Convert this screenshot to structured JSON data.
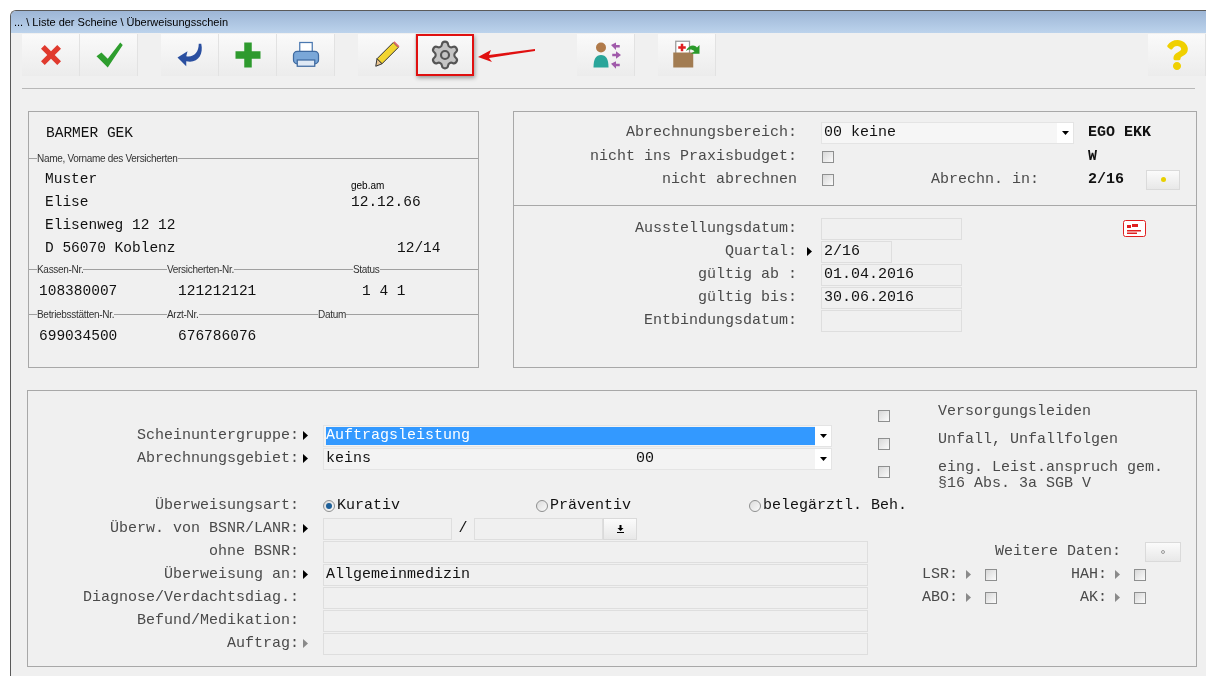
{
  "window": {
    "title": "... \\ Liste der Scheine \\ Überweisungsschein"
  },
  "toolbar": [
    [
      {
        "kind": "cancel",
        "marked": false
      },
      {
        "kind": "confirm",
        "marked": false
      }
    ],
    [
      {
        "kind": "undo",
        "marked": false
      },
      {
        "kind": "add",
        "marked": false
      },
      {
        "kind": "print",
        "marked": false
      }
    ],
    [
      {
        "kind": "edit",
        "marked": false
      },
      {
        "kind": "settings",
        "marked": true
      }
    ],
    [
      {
        "kind": "person-transfer",
        "marked": false
      }
    ],
    [
      {
        "kind": "folder-import",
        "marked": false
      }
    ],
    [
      {
        "kind": "help",
        "marked": false
      }
    ]
  ],
  "insurance_card": {
    "insurer": "BARMER GEK",
    "name_label": "Name, Vorname des Versicherten",
    "surname": "Muster",
    "dob_label": "geb.am",
    "first_name": "Elise",
    "dob": "12.12.66",
    "street": "Elisenweg 12 12",
    "city": "D 56070 Koblenz",
    "card_valid": "12/14",
    "rows": [
      [
        {
          "label": "Kassen-Nr.",
          "value": "108380007"
        },
        {
          "label": "Versicherten-Nr.",
          "value": "121212121"
        },
        {
          "label": "Status",
          "value": "1 4 1"
        }
      ],
      [
        {
          "label": "Betriebsstätten-Nr.",
          "value": "699034500"
        },
        {
          "label": "Arzt-Nr.",
          "value": "676786076"
        },
        {
          "label": "Datum"
        }
      ]
    ]
  },
  "billing": {
    "area_label": "Abrechnungsbereich:",
    "area_value": "00 keine",
    "codes": "EGO EKK",
    "budget_label": "nicht ins Praxisbudget:",
    "budget_checked": false,
    "type_code": "W",
    "no_bill_label": "nicht abrechnen",
    "no_bill_checked": false,
    "bill_in_label": "Abrechn. in:",
    "bill_in": "2/16"
  },
  "dates": [
    {
      "kind": "wide",
      "label": "Ausstellungsdatum:"
    },
    {
      "kind": "short",
      "label": "Quartal:",
      "arrow": true,
      "arrow_disabled": false,
      "value": "2/16"
    },
    {
      "kind": "wide",
      "label": "gültig ab :",
      "value": "01.04.2016"
    },
    {
      "kind": "wide",
      "label": "gültig bis:",
      "value": "30.06.2016"
    },
    {
      "kind": "wide",
      "label": "Entbindungsdatum:"
    }
  ],
  "dropdowns": [
    {
      "label": "Scheinuntergruppe:",
      "arrow": true,
      "arrow_disabled": false,
      "value": "Auftragsleistung",
      "selected": true
    },
    {
      "label": "Abrechnungsgebiet:",
      "arrow": true,
      "arrow_disabled": false,
      "value": "keins",
      "code": "00",
      "selected": false
    }
  ],
  "flags": [
    {
      "label": "Versorgungsleiden",
      "checked": false
    },
    {
      "label": "Unfall, Unfallfolgen",
      "checked": false
    },
    {
      "label": "eing. Leist.anspruch gem. §16 Abs. 3a SGB V",
      "checked": false
    }
  ],
  "referral_type": {
    "label": "Überweisungsart:",
    "options": [
      {
        "label": "Kurativ",
        "selected": true
      },
      {
        "label": "Präventiv",
        "selected": false
      },
      {
        "label": "belegärztl. Beh.",
        "selected": false
      }
    ]
  },
  "fields": [
    {
      "kind": "split",
      "label": "Überw. von BSNR/LANR:",
      "arrow": true,
      "arrow_disabled": false,
      "separator": "/"
    },
    {
      "kind": "text",
      "label": "ohne BSNR:"
    },
    {
      "kind": "text",
      "label": "Überweisung an:",
      "arrow": true,
      "arrow_disabled": false,
      "value": "Allgemeinmedizin"
    },
    {
      "kind": "text",
      "label": "Diagnose/Verdachtsdiag.:"
    },
    {
      "kind": "text",
      "label": "Befund/Medikation:"
    },
    {
      "kind": "text",
      "label": "Auftrag:",
      "arrow": true,
      "arrow_disabled": true
    }
  ],
  "extras": {
    "label": "Weitere Daten:",
    "flags": [
      {
        "label": "LSR:",
        "arrow": true,
        "arrow_disabled": true,
        "checked": false
      },
      {
        "label": "HAH:",
        "arrow": true,
        "arrow_disabled": true,
        "checked": false
      },
      {
        "label": "ABO:",
        "arrow": true,
        "arrow_disabled": true,
        "checked": false
      },
      {
        "label": "AK:",
        "arrow": true,
        "arrow_disabled": true,
        "checked": false
      }
    ]
  }
}
